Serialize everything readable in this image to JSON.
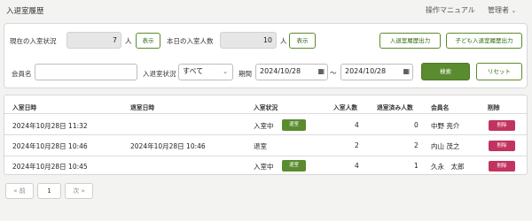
{
  "header": {
    "title": "入退室履歴",
    "manual_label": "操作マニュアル",
    "admin_label": "管理者",
    "admin_chevron": "chevron-down-icon"
  },
  "status": {
    "current_label": "現在の入室状況",
    "current_value": "7",
    "current_unit": "人",
    "current_show": "表示",
    "today_label": "本日の入室人数",
    "today_value": "10",
    "today_unit": "人",
    "today_show": "表示",
    "export_history": "入退室履歴出力",
    "export_child_history": "子ども入退室履歴出力"
  },
  "filters": {
    "member_label": "会員名",
    "member_value": "",
    "status_label": "入退室状況",
    "status_selected": "すべて",
    "period_label": "期間",
    "date_from": "2024/10/28",
    "date_sep": "〜",
    "date_to": "2024/10/28",
    "search_button": "検索",
    "reset_button": "リセット"
  },
  "table": {
    "columns": [
      "入室日時",
      "退室日時",
      "入室状況",
      "入室人数",
      "退室済み人数",
      "会員名",
      "削除"
    ],
    "rows": [
      {
        "in_time": "2024年10月28日 11:32",
        "out_time": "",
        "status": "入室中",
        "action": "退室",
        "in_count": "4",
        "out_count": "0",
        "member": "中野 亮介",
        "delete": "削除"
      },
      {
        "in_time": "2024年10月28日 10:46",
        "out_time": "2024年10月28日 10:46",
        "status": "退室",
        "action": "",
        "in_count": "2",
        "out_count": "2",
        "member": "内山 茂之",
        "delete": "削除"
      },
      {
        "in_time": "2024年10月28日 10:45",
        "out_time": "",
        "status": "入室中",
        "action": "退室",
        "in_count": "4",
        "out_count": "1",
        "member": "久永　太郎",
        "delete": "削除"
      }
    ]
  },
  "pagination": {
    "prev": "« 前",
    "page": "1",
    "next": "次 »"
  },
  "colors": {
    "accent_green": "#5a8b2f",
    "delete_red": "#c2345f"
  }
}
